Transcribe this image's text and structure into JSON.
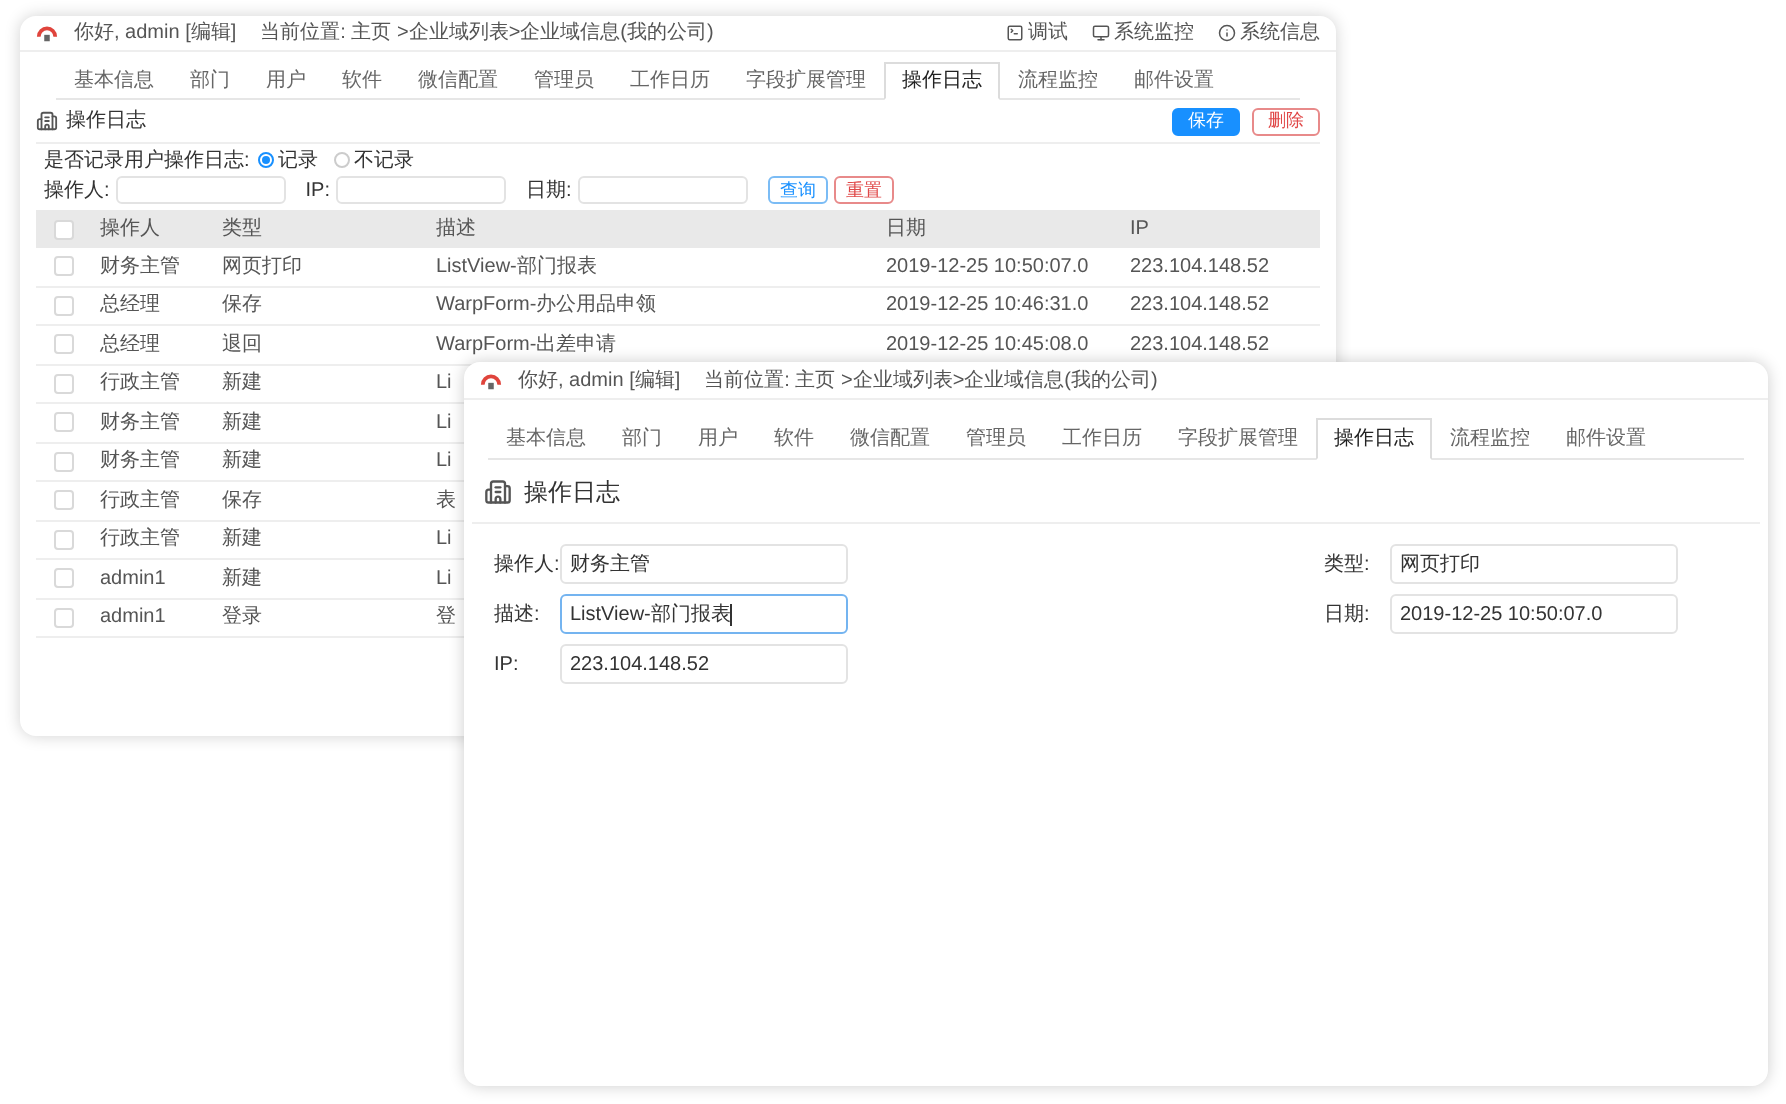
{
  "back_window": {
    "header": {
      "greeting": "你好, admin [编辑]",
      "breadcrumb": "当前位置: 主页 >企业域列表>企业域信息(我的公司)",
      "links": [
        {
          "label": "调试",
          "kind": "debug"
        },
        {
          "label": "系统监控",
          "kind": "monitor"
        },
        {
          "label": "系统信息",
          "kind": "info"
        }
      ]
    },
    "tabs": [
      {
        "label": "基本信息",
        "selected": false
      },
      {
        "label": "部门",
        "selected": false
      },
      {
        "label": "用户",
        "selected": false
      },
      {
        "label": "软件",
        "selected": false
      },
      {
        "label": "微信配置",
        "selected": false
      },
      {
        "label": "管理员",
        "selected": false
      },
      {
        "label": "工作日历",
        "selected": false
      },
      {
        "label": "字段扩展管理",
        "selected": false
      },
      {
        "label": "操作日志",
        "selected": true
      },
      {
        "label": "流程监控",
        "selected": false
      },
      {
        "label": "邮件设置",
        "selected": false
      }
    ],
    "section_title": "操作日志",
    "actions": [
      {
        "label": "保存",
        "kind": "primary"
      },
      {
        "label": "删除",
        "kind": "danger"
      }
    ],
    "log_setting": {
      "label": "是否记录用户操作日志:",
      "options": [
        {
          "label": "记录",
          "selected": true
        },
        {
          "label": "不记录",
          "selected": false
        }
      ]
    },
    "filters": [
      {
        "label": "操作人:"
      },
      {
        "label": "IP:"
      },
      {
        "label": "日期:"
      }
    ],
    "filter_buttons": [
      {
        "label": "查询",
        "kind": "primary"
      },
      {
        "label": "重置",
        "kind": "danger"
      }
    ],
    "table": {
      "header_checked": false,
      "columns": [
        "操作人",
        "类型",
        "描述",
        "日期",
        "IP"
      ],
      "rows": [
        {
          "checked": false,
          "cells": [
            "财务主管",
            "网页打印",
            "ListView-部门报表",
            "2019-12-25 10:50:07.0",
            "223.104.148.52"
          ]
        },
        {
          "checked": false,
          "cells": [
            "总经理",
            "保存",
            "WarpForm-办公用品申领",
            "2019-12-25 10:46:31.0",
            "223.104.148.52"
          ]
        },
        {
          "checked": false,
          "cells": [
            "总经理",
            "退回",
            "WarpForm-出差申请",
            "2019-12-25 10:45:08.0",
            "223.104.148.52"
          ]
        },
        {
          "checked": false,
          "cells": [
            "行政主管",
            "新建",
            "Li"
          ]
        },
        {
          "checked": false,
          "cells": [
            "财务主管",
            "新建",
            "Li"
          ]
        },
        {
          "checked": false,
          "cells": [
            "财务主管",
            "新建",
            "Li"
          ]
        },
        {
          "checked": false,
          "cells": [
            "行政主管",
            "保存",
            "表"
          ]
        },
        {
          "checked": false,
          "cells": [
            "行政主管",
            "新建",
            "Li"
          ]
        },
        {
          "checked": false,
          "cells": [
            "admin1",
            "新建",
            "Li"
          ]
        },
        {
          "checked": false,
          "cells": [
            "admin1",
            "登录",
            "登"
          ]
        }
      ]
    }
  },
  "front_window": {
    "header": {
      "greeting": "你好, admin [编辑]",
      "breadcrumb": "当前位置: 主页 >企业域列表>企业域信息(我的公司)"
    },
    "tabs": [
      {
        "label": "基本信息",
        "selected": false
      },
      {
        "label": "部门",
        "selected": false
      },
      {
        "label": "用户",
        "selected": false
      },
      {
        "label": "软件",
        "selected": false
      },
      {
        "label": "微信配置",
        "selected": false
      },
      {
        "label": "管理员",
        "selected": false
      },
      {
        "label": "工作日历",
        "selected": false
      },
      {
        "label": "字段扩展管理",
        "selected": false
      },
      {
        "label": "操作日志",
        "selected": true
      },
      {
        "label": "流程监控",
        "selected": false
      },
      {
        "label": "邮件设置",
        "selected": false
      }
    ],
    "section_title": "操作日志",
    "left_fields": [
      {
        "label": "操作人:",
        "value": "财务主管",
        "focused": false
      },
      {
        "label": "描述:",
        "value": "ListView-部门报表",
        "focused": true
      },
      {
        "label": "IP:",
        "value": "223.104.148.52",
        "focused": false
      }
    ],
    "right_fields": [
      {
        "label": "类型:",
        "value": "网页打印",
        "focused": false
      },
      {
        "label": "日期:",
        "value": "2019-12-25 10:50:07.0",
        "focused": false
      }
    ]
  }
}
